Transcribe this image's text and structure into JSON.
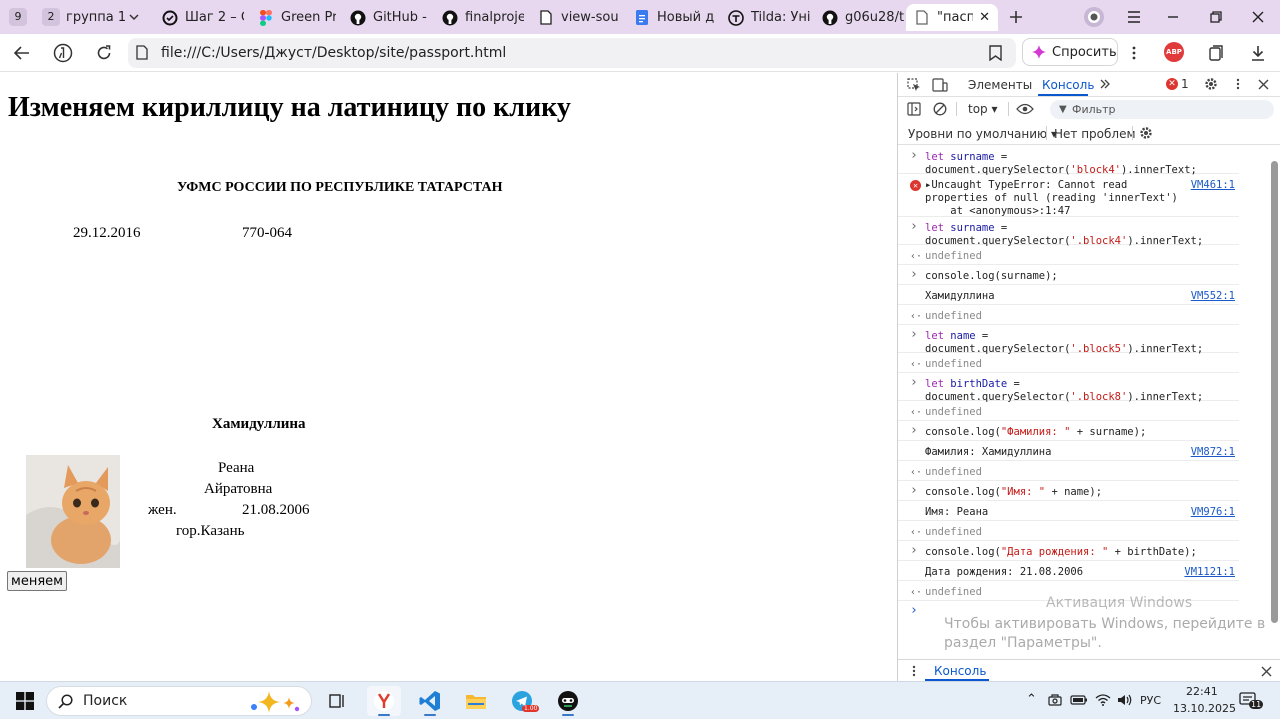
{
  "tabs": {
    "counter": "9",
    "group_count": "2",
    "group_label": "группа 1",
    "items": [
      {
        "label": "Шаг 2 – С"
      },
      {
        "label": "Green Pr"
      },
      {
        "label": "GitHub -"
      },
      {
        "label": "finalproje"
      },
      {
        "label": "view-sou"
      },
      {
        "label": "Новый д"
      },
      {
        "label": "Tilda: Уні"
      },
      {
        "label": "g06u28/t"
      },
      {
        "label": "\"паспо"
      }
    ]
  },
  "toolbar": {
    "url": "file:///C:/Users/Джуст/Desktop/site/passport.html",
    "ask_label": "Спросить",
    "abp_label": "ABP"
  },
  "page": {
    "heading": "Изменяем кириллицу на латиницу по клику",
    "issuer": "УФМС РОССИИ ПО РЕСПУБЛИКЕ ТАТАРСТАН",
    "issue_date": "29.12.2016",
    "division_code": "770-064",
    "surname": "Хамидуллина",
    "name": "Реана",
    "patronymic": "Айратовна",
    "sex": "жен.",
    "birth_date": "21.08.2006",
    "birth_place": "гор.Казань",
    "button_label": "меняем"
  },
  "devtools": {
    "tab_elements": "Элементы",
    "tab_console": "Консоль",
    "error_count": "1",
    "context": "top",
    "filter_placeholder": "Фильтр",
    "levels": "Уровни по умолчанию",
    "issues": "Нет проблем",
    "drawer_tab": "Консоль",
    "console": [
      {
        "kind": "input",
        "line1": "let surname =",
        "line2": "document.querySelector('block4').innerText;"
      },
      {
        "kind": "error",
        "line1": "Uncaught TypeError: Cannot read",
        "line2": "properties of null (reading 'innerText')",
        "line3": "    at <anonymous>:1:47",
        "source": "VM461:1"
      },
      {
        "kind": "input",
        "line1": "let surname =",
        "line2": "document.querySelector('.block4').innerText;"
      },
      {
        "kind": "undef",
        "text": "undefined"
      },
      {
        "kind": "input",
        "line1": "console.log(surname);"
      },
      {
        "kind": "output",
        "text": "Хамидуллина",
        "source": "VM552:1"
      },
      {
        "kind": "undef",
        "text": "undefined"
      },
      {
        "kind": "input",
        "line1": "let name =",
        "line2": "document.querySelector('.block5').innerText;"
      },
      {
        "kind": "undef",
        "text": "undefined"
      },
      {
        "kind": "input",
        "line1": "let birthDate =",
        "line2": "document.querySelector('.block8').innerText;"
      },
      {
        "kind": "undef",
        "text": "undefined"
      },
      {
        "kind": "input",
        "line1": "console.log(\"Фамилия: \" + surname);"
      },
      {
        "kind": "output",
        "text": "Фамилия: Хамидуллина",
        "source": "VM872:1"
      },
      {
        "kind": "undef",
        "text": "undefined"
      },
      {
        "kind": "input",
        "line1": "console.log(\"Имя: \" + name);"
      },
      {
        "kind": "output",
        "text": "Имя: Реана",
        "source": "VM976:1"
      },
      {
        "kind": "undef",
        "text": "undefined"
      },
      {
        "kind": "input",
        "line1": "console.log(\"Дата рождения: \" + birthDate);"
      },
      {
        "kind": "output",
        "text": "Дата рождения: 21.08.2006",
        "source": "VM1121:1"
      },
      {
        "kind": "undef",
        "text": "undefined"
      }
    ]
  },
  "watermark": {
    "line1": "Активация Windows",
    "line2": "Чтобы активировать Windows, перейдите в",
    "line3": "раздел \"Параметры\"."
  },
  "taskbar": {
    "search_label": "Поиск",
    "lang": "РУС",
    "time": "22:41",
    "date": "13.10.2025",
    "notif_count": "11",
    "telegram_badge": "1.00"
  }
}
